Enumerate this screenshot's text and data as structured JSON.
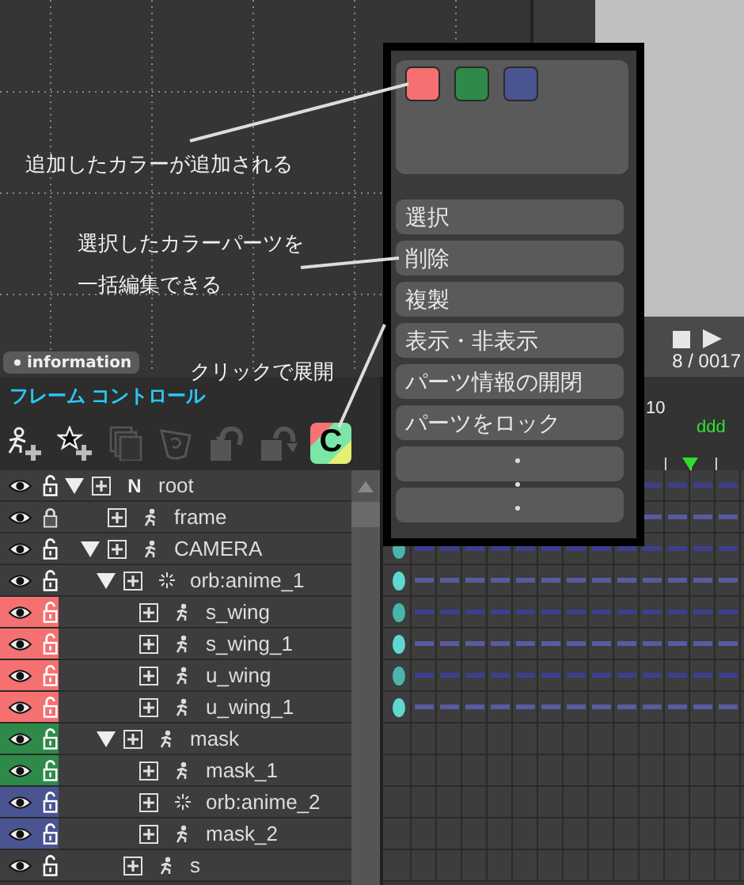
{
  "annotations": [
    {
      "text": "追加したカラーが追加される"
    },
    {
      "text": "選択したカラーパーツを"
    },
    {
      "text": "一括編集できる"
    },
    {
      "text": "クリックで展開"
    }
  ],
  "information_tab": {
    "label": "information"
  },
  "playback": {
    "frame_counter": "8 / 0017"
  },
  "panel": {
    "title": "フレーム コントロール"
  },
  "toolbar": [
    {
      "kind": "add-part",
      "disabled": false
    },
    {
      "kind": "add-null",
      "disabled": false
    },
    {
      "kind": "copy",
      "disabled": true
    },
    {
      "kind": "cup",
      "disabled": true
    },
    {
      "kind": "undo",
      "disabled": true
    },
    {
      "kind": "redo",
      "disabled": true
    },
    {
      "kind": "color",
      "disabled": false,
      "label": "C"
    }
  ],
  "tree": [
    {
      "name": "root",
      "kind": "null",
      "badge": "N",
      "locked": false,
      "keyframes": true,
      "expanded": true,
      "children": [
        {
          "name": "frame",
          "kind": "part",
          "locked": true,
          "keyframes": true
        },
        {
          "name": "CAMERA",
          "kind": "part",
          "locked": false,
          "keyframes": true,
          "expanded": true,
          "children": [
            {
              "name": "orb:anime_1",
              "kind": "effect",
              "locked": false,
              "keyframes": true,
              "expanded": true,
              "children": [
                {
                  "name": "s_wing",
                  "kind": "part",
                  "locked": false,
                  "keyframes": true,
                  "color": "#f57070"
                },
                {
                  "name": "s_wing_1",
                  "kind": "part",
                  "locked": false,
                  "keyframes": true,
                  "color": "#f57070"
                },
                {
                  "name": "u_wing",
                  "kind": "part",
                  "locked": false,
                  "keyframes": true,
                  "color": "#f57070"
                },
                {
                  "name": "u_wing_1",
                  "kind": "part",
                  "locked": false,
                  "keyframes": true,
                  "color": "#f57070"
                }
              ]
            },
            {
              "name": "mask",
              "kind": "part",
              "locked": false,
              "keyframes": false,
              "color": "#2e8a48",
              "expanded": true,
              "children": [
                {
                  "name": "mask_1",
                  "kind": "part",
                  "locked": false,
                  "keyframes": false,
                  "color": "#2e8a48"
                },
                {
                  "name": "orb:anime_2",
                  "kind": "effect",
                  "locked": false,
                  "keyframes": false,
                  "color": "#4a5490"
                },
                {
                  "name": "mask_2",
                  "kind": "part",
                  "locked": false,
                  "keyframes": false,
                  "color": "#4a5490"
                }
              ]
            },
            {
              "name": "s",
              "kind": "part",
              "locked": false,
              "keyframes": false
            }
          ]
        }
      ]
    }
  ],
  "timeline": {
    "ruler_label": "10",
    "marker_label": "ddd"
  },
  "color_popup": {
    "swatches": [
      {
        "color": "#f57070"
      },
      {
        "color": "#2e8a48"
      },
      {
        "color": "#4a5490"
      }
    ],
    "menu": [
      {
        "kind": "item",
        "label": "選択"
      },
      {
        "kind": "item",
        "label": "削除"
      },
      {
        "kind": "item",
        "label": "複製"
      },
      {
        "kind": "item",
        "label": "表示・非表示"
      },
      {
        "kind": "item",
        "label": "パーツ情報の開閉"
      },
      {
        "kind": "item",
        "label": "パーツをロック"
      },
      {
        "kind": "more"
      },
      {
        "kind": "more"
      }
    ]
  }
}
